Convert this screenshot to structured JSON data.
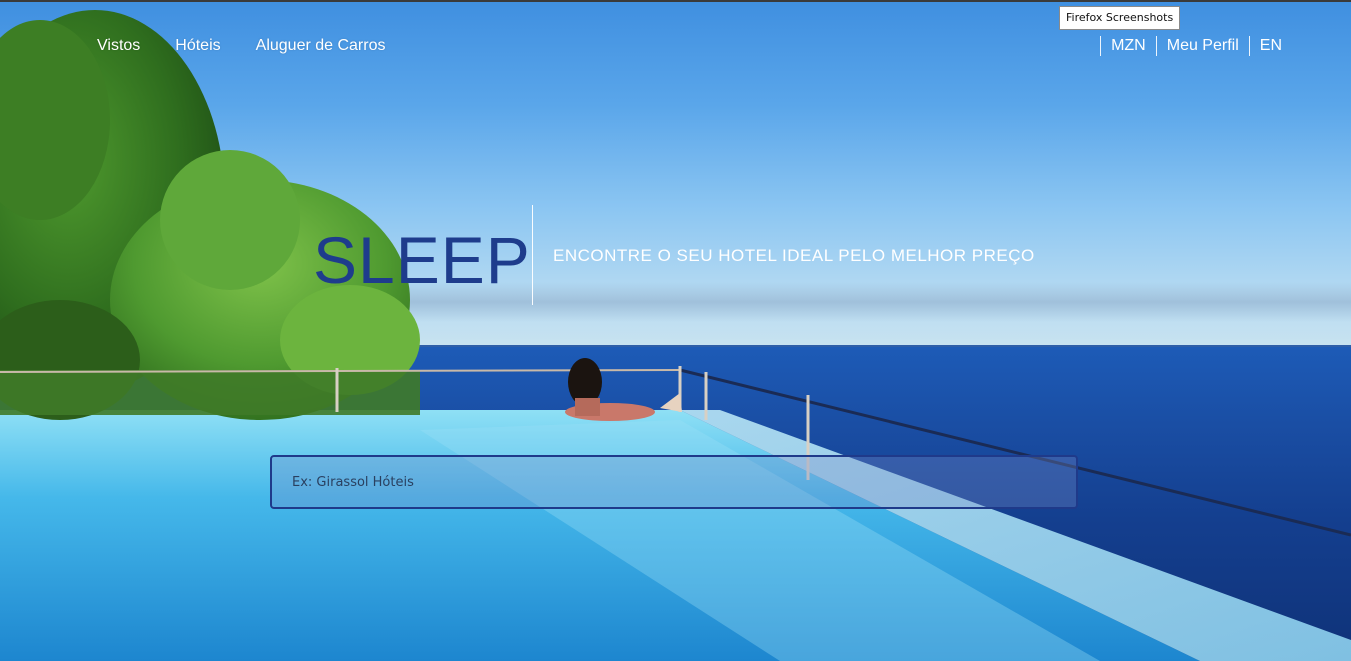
{
  "browser": {
    "tooltip": "Firefox Screenshots"
  },
  "nav": {
    "left": [
      "Vistos",
      "Hóteis",
      "Aluguer de Carros"
    ],
    "currency": "MZN",
    "profile": "Meu Perfil",
    "language": "EN"
  },
  "hero": {
    "brand": "SLEEP",
    "tagline": "ENCONTRE O SEU HOTEL IDEAL PELO MELHOR PREÇO"
  },
  "search": {
    "placeholder": "Ex: Girassol Hóteis",
    "value": ""
  },
  "colors": {
    "brand": "#1e3c8c",
    "search_border": "#1f3a8a"
  }
}
